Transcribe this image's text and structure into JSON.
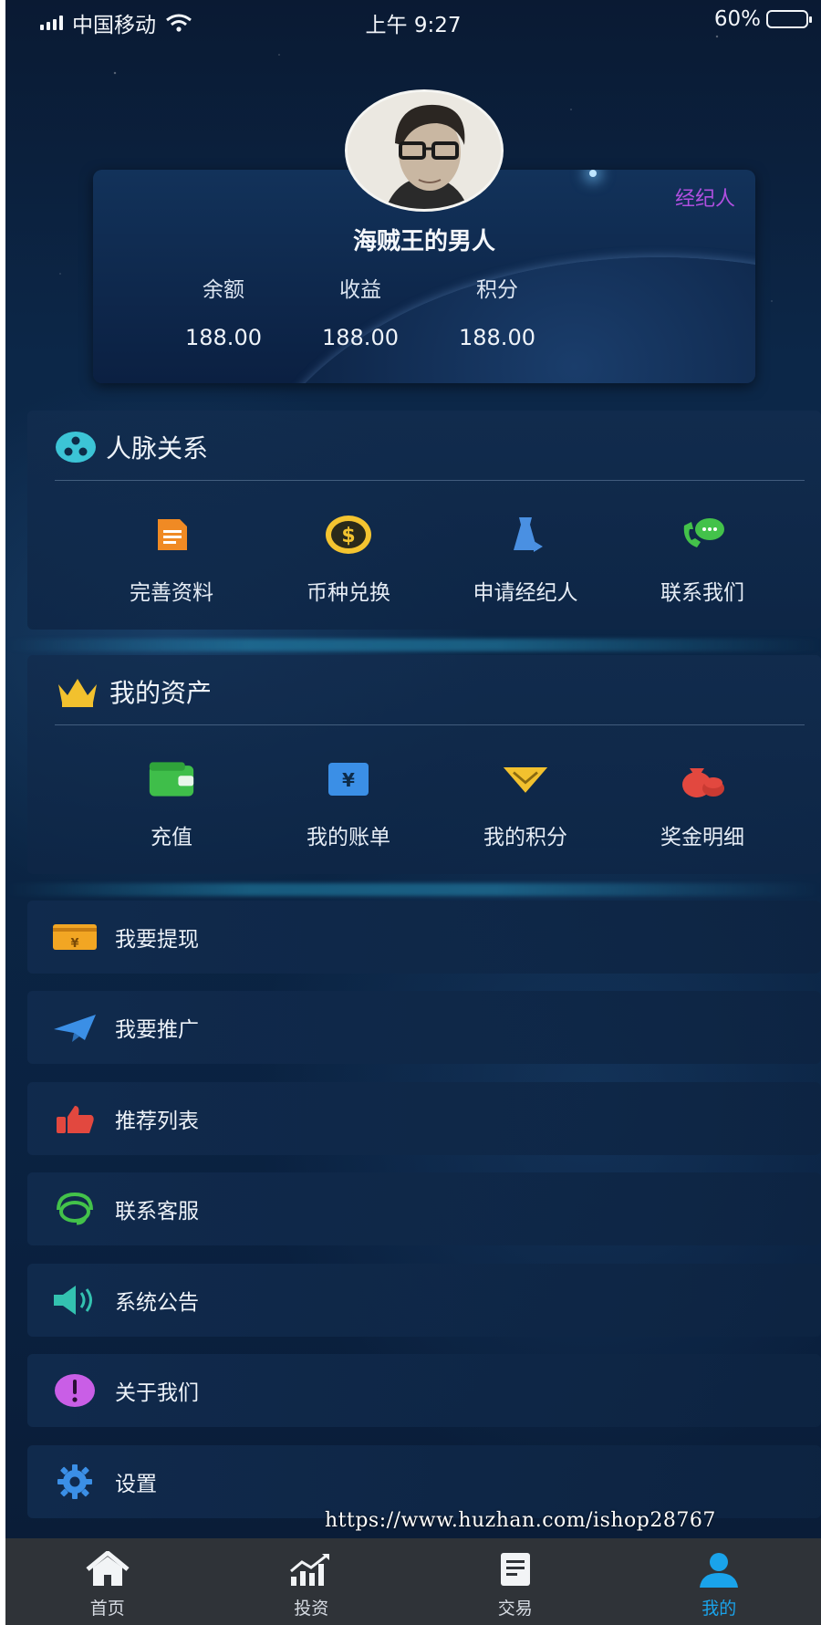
{
  "status_bar": {
    "carrier": "中国移动",
    "time": "上午 9:27",
    "battery": "60%"
  },
  "profile": {
    "role_badge": "经纪人",
    "username": "海贼王的男人",
    "stats": [
      {
        "label": "余额",
        "value": "188.00"
      },
      {
        "label": "收益",
        "value": "188.00"
      },
      {
        "label": "积分",
        "value": "188.00"
      }
    ]
  },
  "network_section": {
    "title": "人脉关系",
    "items": [
      {
        "label": "完善资料",
        "icon": "document-icon"
      },
      {
        "label": "币种兑换",
        "icon": "coin-exchange-icon"
      },
      {
        "label": "申请经纪人",
        "icon": "agent-icon"
      },
      {
        "label": "联系我们",
        "icon": "phone-chat-icon"
      }
    ]
  },
  "assets_section": {
    "title": "我的资产",
    "items": [
      {
        "label": "充值",
        "icon": "wallet-icon"
      },
      {
        "label": "我的账单",
        "icon": "bill-icon"
      },
      {
        "label": "我的积分",
        "icon": "points-icon"
      },
      {
        "label": "奖金明细",
        "icon": "bonus-bag-icon"
      }
    ]
  },
  "menu": [
    {
      "label": "我要提现",
      "icon": "withdraw-card-icon"
    },
    {
      "label": "我要推广",
      "icon": "paper-plane-icon"
    },
    {
      "label": "推荐列表",
      "icon": "thumbs-up-icon"
    },
    {
      "label": "联系客服",
      "icon": "headset-icon"
    },
    {
      "label": "系统公告",
      "icon": "speaker-icon"
    },
    {
      "label": "关于我们",
      "icon": "info-exclamation-icon"
    },
    {
      "label": "设置",
      "icon": "gear-icon"
    }
  ],
  "watermark": "https://www.huzhan.com/ishop28767",
  "tabbar": {
    "active": "我的",
    "tabs": [
      {
        "label": "首页",
        "icon": "home-icon"
      },
      {
        "label": "投资",
        "icon": "chart-icon"
      },
      {
        "label": "交易",
        "icon": "document-icon"
      },
      {
        "label": "我的",
        "icon": "user-icon"
      }
    ]
  },
  "colors": {
    "accent": "#1aa3ea",
    "role_badge": "#b04fe0",
    "tabbar_bg": "#2f3338"
  }
}
